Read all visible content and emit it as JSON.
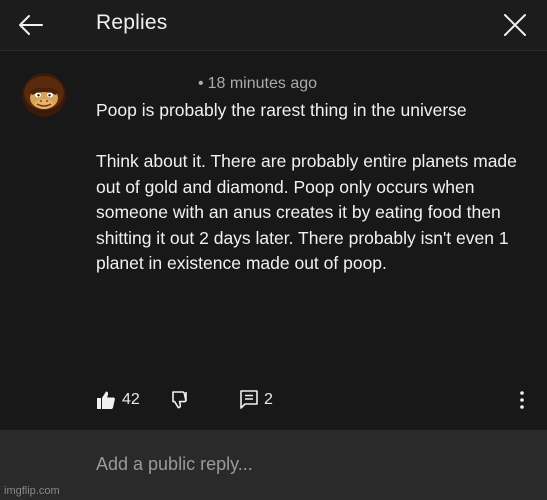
{
  "header": {
    "title": "Replies",
    "back_icon": "arrow-left-icon",
    "close_icon": "close-icon"
  },
  "comment": {
    "avatar_icon": "donkey-kong-avatar",
    "timestamp": "18 minutes ago",
    "separator": "•",
    "paragraphs": [
      "Poop is probably the rarest thing in the universe",
      "Think about it. There are probably entire planets made out of gold and diamond. Poop only occurs when someone with an anus creates it by eating food then shitting it out 2 days later. There probably isn't even 1 planet in existence made out of poop."
    ],
    "likes": "42",
    "replies": "2"
  },
  "reply_bar": {
    "placeholder": "Add a public reply..."
  },
  "watermark": "imgflip.com",
  "colors": {
    "background": "#181818",
    "reply_bar": "#2a2a2a",
    "text": "#f1f1f1",
    "muted": "#aaaaaa"
  }
}
